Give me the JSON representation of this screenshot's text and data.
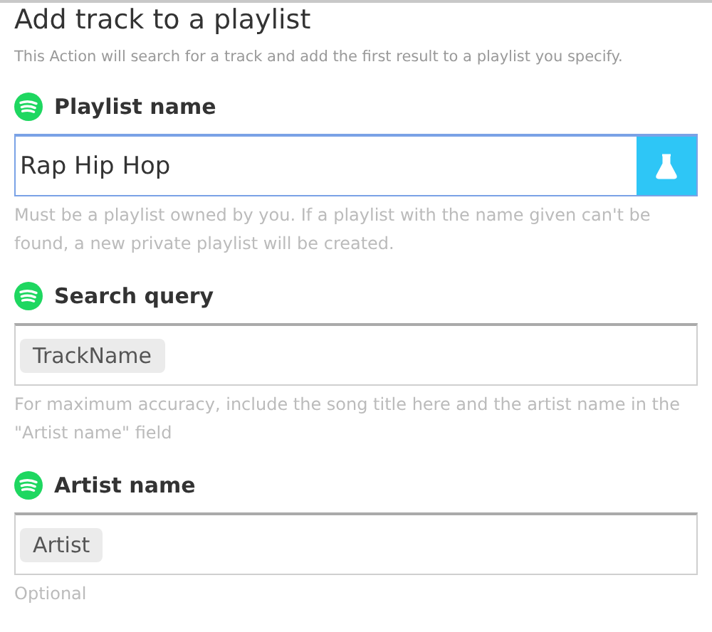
{
  "title": "Add track to a playlist",
  "description": "This Action will search for a track and add the first result to a playlist you specify.",
  "fields": [
    {
      "label": "Playlist name",
      "kind": "text",
      "value": "Rap Hip Hop",
      "focused": true,
      "help": "Must be a playlist owned by you. If a playlist with the name given can't be found, a new private playlist will be created."
    },
    {
      "label": "Search query",
      "kind": "token",
      "value": "TrackName",
      "focused": false,
      "help": "For maximum accuracy, include the song title here and the artist name in the \"Artist name\" field"
    },
    {
      "label": "Artist name",
      "kind": "token",
      "value": "Artist",
      "focused": false,
      "help": "Optional"
    }
  ]
}
